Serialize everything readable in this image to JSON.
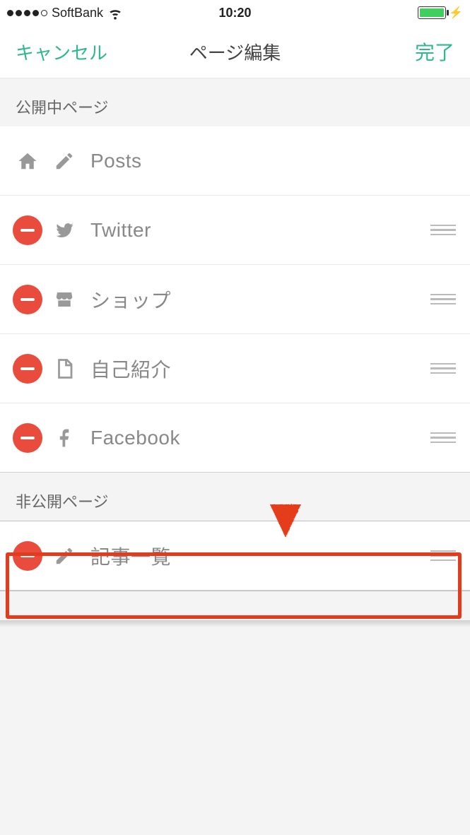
{
  "status": {
    "carrier": "SoftBank",
    "time": "10:20",
    "battery_percent": 95
  },
  "nav": {
    "cancel": "キャンセル",
    "title": "ページ編集",
    "done": "完了"
  },
  "sections": {
    "public": {
      "header": "公開中ページ"
    },
    "private": {
      "header": "非公開ページ"
    }
  },
  "rows": {
    "posts": {
      "label": "Posts",
      "deletable": false
    },
    "twitter": {
      "label": "Twitter",
      "deletable": true
    },
    "shop": {
      "label": "ショップ",
      "deletable": true
    },
    "profile": {
      "label": "自己紹介",
      "deletable": true
    },
    "facebook": {
      "label": "Facebook",
      "deletable": true
    },
    "articles": {
      "label": "記事一覧",
      "deletable": true
    }
  },
  "annotation": {
    "arrow_color": "#e33c1c",
    "highlight_color": "#e33c1c"
  }
}
